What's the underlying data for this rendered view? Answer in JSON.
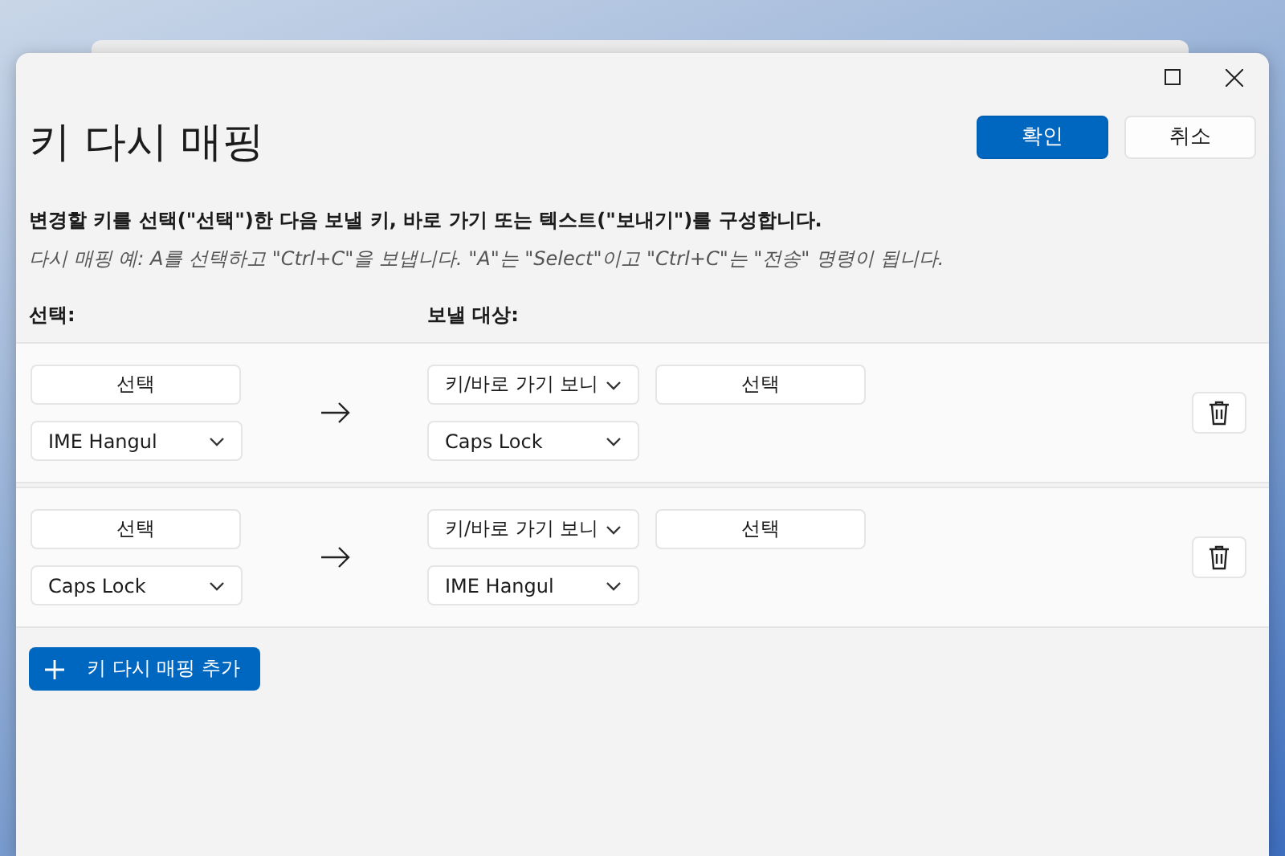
{
  "title": "키 다시 매핑",
  "buttons": [
    {
      "label": "확인",
      "kind": "primary"
    },
    {
      "label": "취소",
      "kind": "secondary"
    }
  ],
  "instruction": "변경할 키를 선택(\"선택\")한 다음 보낼 키, 바로 가기 또는 텍스트(\"보내기\")를 구성합니다.",
  "example": "다시 매핑 예: A를 선택하고 \"Ctrl+C\"을 보냅니다. \"A\"는 \"Select\"이고 \"Ctrl+C\"는 \"전송\" 명령이 됩니다.",
  "column_headers": [
    "선택:",
    "보낼 대상:"
  ],
  "rows": [
    {
      "select_label": "선택",
      "original_key": "IME Hangul",
      "send_type": "키/바로 가기 보니",
      "send_select_label": "선택",
      "target_key": "Caps Lock"
    },
    {
      "select_label": "선택",
      "original_key": "Caps Lock",
      "send_type": "키/바로 가기 보니",
      "send_select_label": "선택",
      "target_key": "IME Hangul"
    }
  ],
  "add_button": "키 다시 매핑 추가"
}
